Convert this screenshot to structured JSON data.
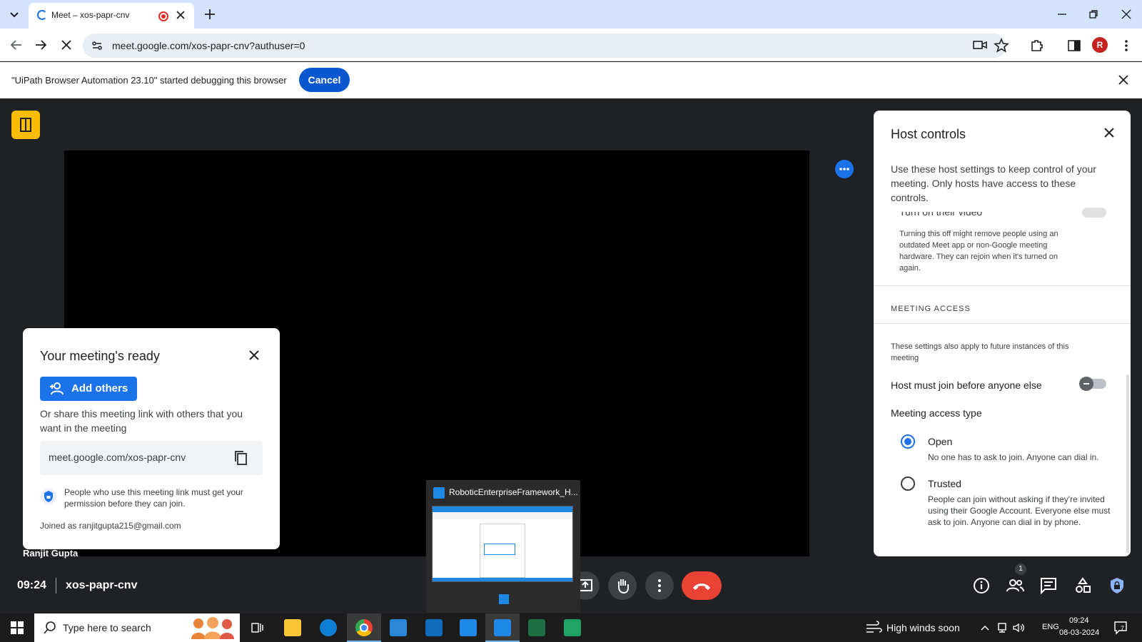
{
  "browser": {
    "tab_title": "Meet – xos-papr-cnv",
    "url": "meet.google.com/xos-papr-cnv?authuser=0",
    "profile_initial": "R"
  },
  "infobar": {
    "message": "\"UiPath Browser Automation 23.10\" started debugging this browser",
    "cancel_label": "Cancel"
  },
  "ready_card": {
    "title": "Your meeting's ready",
    "add_others_label": "Add others",
    "share_text": "Or share this meeting link with others that you want in the meeting",
    "link": "meet.google.com/xos-papr-cnv",
    "permission_text": "People who use this meeting link must get your permission before they can join.",
    "joined_as": "Joined as ranjitgupta215@gmail.com"
  },
  "presenter_name": "Ranjit Gupta",
  "host_controls": {
    "title": "Host controls",
    "description": "Use these host settings to keep control of your meeting. Only hosts have access to these controls.",
    "cut_off_item": "Turn on their video",
    "turn_off_desc": "Turning this off might remove people using an outdated Meet app or non-Google meeting hardware. They can rejoin when it's turned on again.",
    "access_header": "MEETING ACCESS",
    "future_text": "These settings also apply to future instances of this meeting",
    "host_join_label": "Host must join before anyone else",
    "access_type_label": "Meeting access type",
    "open_label": "Open",
    "open_desc": "No one has to ask to join. Anyone can dial in.",
    "trusted_label": "Trusted",
    "trusted_desc": "People can join without asking if they're invited using their Google Account. Everyone else must ask to join. Anyone can dial in by phone.",
    "selected_access": "Open"
  },
  "bottom_bar": {
    "time": "09:24",
    "meeting_code": "xos-papr-cnv",
    "people_badge": "1"
  },
  "thumbnail": {
    "title": "RoboticEnterpriseFramework_H..."
  },
  "taskbar": {
    "search_placeholder": "Type here to search",
    "weather": "High winds soon",
    "lang": "ENG",
    "clock_time": "09:24",
    "clock_date": "08-03-2024",
    "notification_count": "7"
  },
  "colors": {
    "accent": "#1a73e8",
    "hangup": "#ea4335",
    "chrome_tabstrip": "#d3e3fd"
  }
}
